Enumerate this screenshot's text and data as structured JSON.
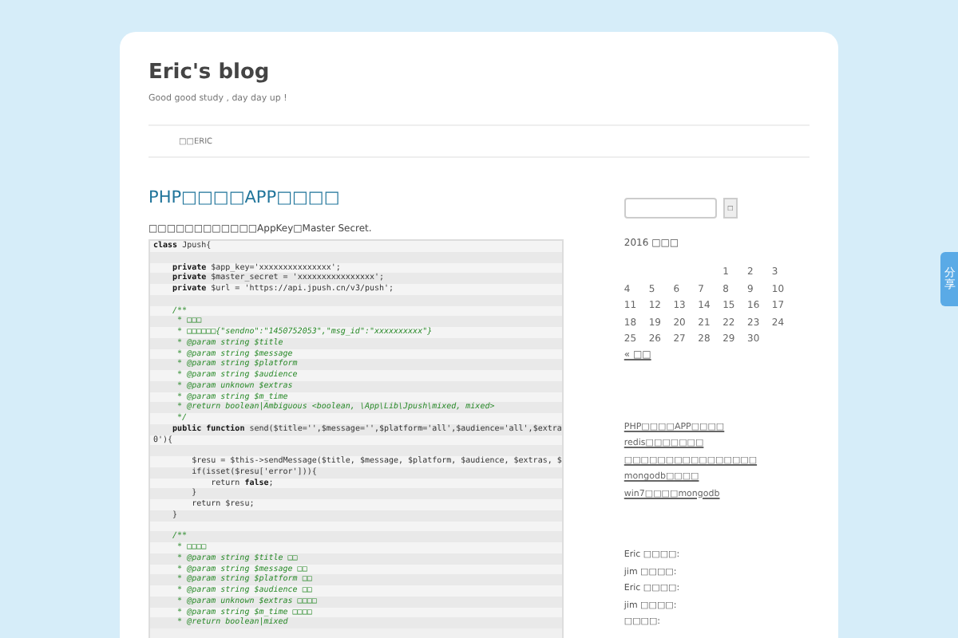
{
  "site": {
    "title": "Eric's blog",
    "tagline": "Good good study , day day up !"
  },
  "nav": [
    {
      "label": "□□ERIC"
    }
  ],
  "post": {
    "title": "PHP□□□□APP□□□□",
    "intro": "□□□□□□□□□□□□AppKey□Master Secret.",
    "code": [
      {
        "kind": "code",
        "text": "**class** Jpush{"
      },
      {
        "kind": "blank"
      },
      {
        "kind": "code",
        "text": "    **private** $app_key='xxxxxxxxxxxxxxx';"
      },
      {
        "kind": "code",
        "text": "    **private** $master_secret = 'xxxxxxxxxxxxxxxx';"
      },
      {
        "kind": "code",
        "text": "    **private** $url = 'https://api.jpush.cn/v3/push';"
      },
      {
        "kind": "blank"
      },
      {
        "kind": "comment",
        "text": "    /**"
      },
      {
        "kind": "comment",
        "text": "     * □□□"
      },
      {
        "kind": "comment",
        "text": "     * □□□□□□{\"sendno\":\"1450752053\",\"msg_id\":\"xxxxxxxxxx\"}"
      },
      {
        "kind": "comment",
        "text": "     * @param string $title"
      },
      {
        "kind": "comment",
        "text": "     * @param string $message"
      },
      {
        "kind": "comment",
        "text": "     * @param string $platform"
      },
      {
        "kind": "comment",
        "text": "     * @param string $audience"
      },
      {
        "kind": "comment",
        "text": "     * @param unknown $extras"
      },
      {
        "kind": "comment",
        "text": "     * @param string $m_time"
      },
      {
        "kind": "comment",
        "text": "     * @return boolean|Ambiguous <boolean, \\App\\Lib\\Jpush\\mixed, mixed>"
      },
      {
        "kind": "comment",
        "text": "     */"
      },
      {
        "kind": "code",
        "text": "    **public function** send($title='',$message='',$platform='all',$audience='all',$extra"
      },
      {
        "kind": "code",
        "text": "0'){"
      },
      {
        "kind": "blank"
      },
      {
        "kind": "code",
        "text": "        $resu = $this->sendMessage($title, $message, $platform, $audience, $extras, $"
      },
      {
        "kind": "code",
        "text": "        if(isset($resu['error'])){"
      },
      {
        "kind": "code",
        "text": "            return **false**;"
      },
      {
        "kind": "code",
        "text": "        }"
      },
      {
        "kind": "code",
        "text": "        return $resu;"
      },
      {
        "kind": "code",
        "text": "    }"
      },
      {
        "kind": "blank"
      },
      {
        "kind": "comment",
        "text": "    /**"
      },
      {
        "kind": "comment",
        "text": "     * □□□□"
      },
      {
        "kind": "comment",
        "text": "     * @param string $title □□"
      },
      {
        "kind": "comment",
        "text": "     * @param string $message □□"
      },
      {
        "kind": "comment",
        "text": "     * @param string $platform □□"
      },
      {
        "kind": "comment",
        "text": "     * @param string $audience □□"
      },
      {
        "kind": "comment",
        "text": "     * @param unknown $extras □□□□"
      },
      {
        "kind": "comment",
        "text": "     * @param string $m_time □□□□"
      },
      {
        "kind": "comment",
        "text": "     * @return boolean|mixed"
      }
    ]
  },
  "sidebar": {
    "search_button": "□",
    "calendar": {
      "caption": "2016 □□□",
      "weeks": [
        {
          "kind": "starts_late",
          "days": [
            "1",
            "2",
            "3"
          ]
        },
        {
          "kind": "full",
          "days": [
            "4",
            "5",
            "6",
            "7",
            "8",
            "9",
            "10"
          ]
        },
        {
          "kind": "full",
          "days": [
            "11",
            "12",
            "13",
            "14",
            "15",
            "16",
            "17"
          ]
        },
        {
          "kind": "full",
          "days": [
            "18",
            "19",
            "20",
            "21",
            "22",
            "23",
            "24"
          ]
        },
        {
          "kind": "ends_early",
          "days": [
            "25",
            "26",
            "27",
            "28",
            "29",
            "30"
          ]
        }
      ],
      "prev_link": "« □□"
    },
    "recent_posts": [
      "PHP□□□□APP□□□□",
      "redis□□□□□□□",
      "□□□□□□□□□□□□□□□□",
      "mongodb□□□□",
      "win7□□□□mongodb"
    ],
    "recent_comments": [
      "Eric □□□□:",
      "jim □□□□:",
      "Eric □□□□:",
      "jim □□□□:",
      "□□□□:"
    ]
  },
  "share_tab": "分享"
}
